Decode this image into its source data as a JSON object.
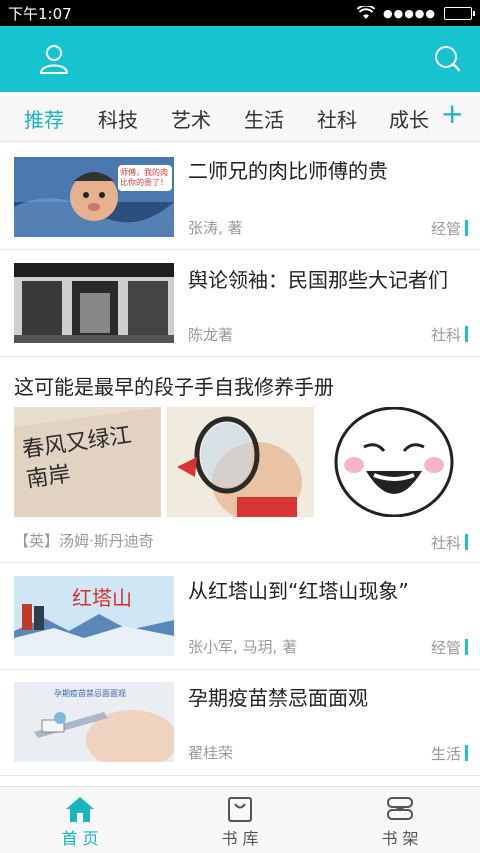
{
  "status_bar": {
    "time": "下午1:07",
    "signal": "●●●●●"
  },
  "header": {
    "user_icon": "user-icon",
    "search_icon": "search-icon"
  },
  "tabs": [
    {
      "label": "推荐",
      "active": true
    },
    {
      "label": "科技"
    },
    {
      "label": "艺术"
    },
    {
      "label": "生活"
    },
    {
      "label": "社科"
    },
    {
      "label": "成长"
    }
  ],
  "tab_add": "+",
  "feed": {
    "items": [
      {
        "title": "二师兄的肉比师傅的贵",
        "author": "张涛, 著",
        "category": "经管",
        "thumb_text": "师傅，我的肉比你的贵了！"
      },
      {
        "title": "舆论领袖：民国那些大记者们",
        "author": "陈龙著",
        "category": "社科"
      }
    ],
    "feature": {
      "title": "这可能是最早的段子手自我修养手册",
      "author": "【英】汤姆·斯丹迪奇",
      "category": "社科",
      "img1_text": "春风又绿江南岸"
    },
    "items2": [
      {
        "title": "从红塔山到“红塔山现象”",
        "author": "张小军, 马玥, 著",
        "category": "经管",
        "thumb_text": "红塔山"
      },
      {
        "title": "孕期疫苗禁忌面面观",
        "author": "翟桂荣",
        "category": "生活",
        "thumb_text": "孕期疫苗禁忌面面观"
      }
    ]
  },
  "bottom_nav": [
    {
      "label": "首 页",
      "active": true,
      "icon": "home-icon"
    },
    {
      "label": "书 库",
      "icon": "bag-icon"
    },
    {
      "label": "书 架",
      "icon": "shelf-icon"
    }
  ],
  "colors": {
    "accent": "#17c3cf",
    "accent_text": "#17b5c4"
  }
}
